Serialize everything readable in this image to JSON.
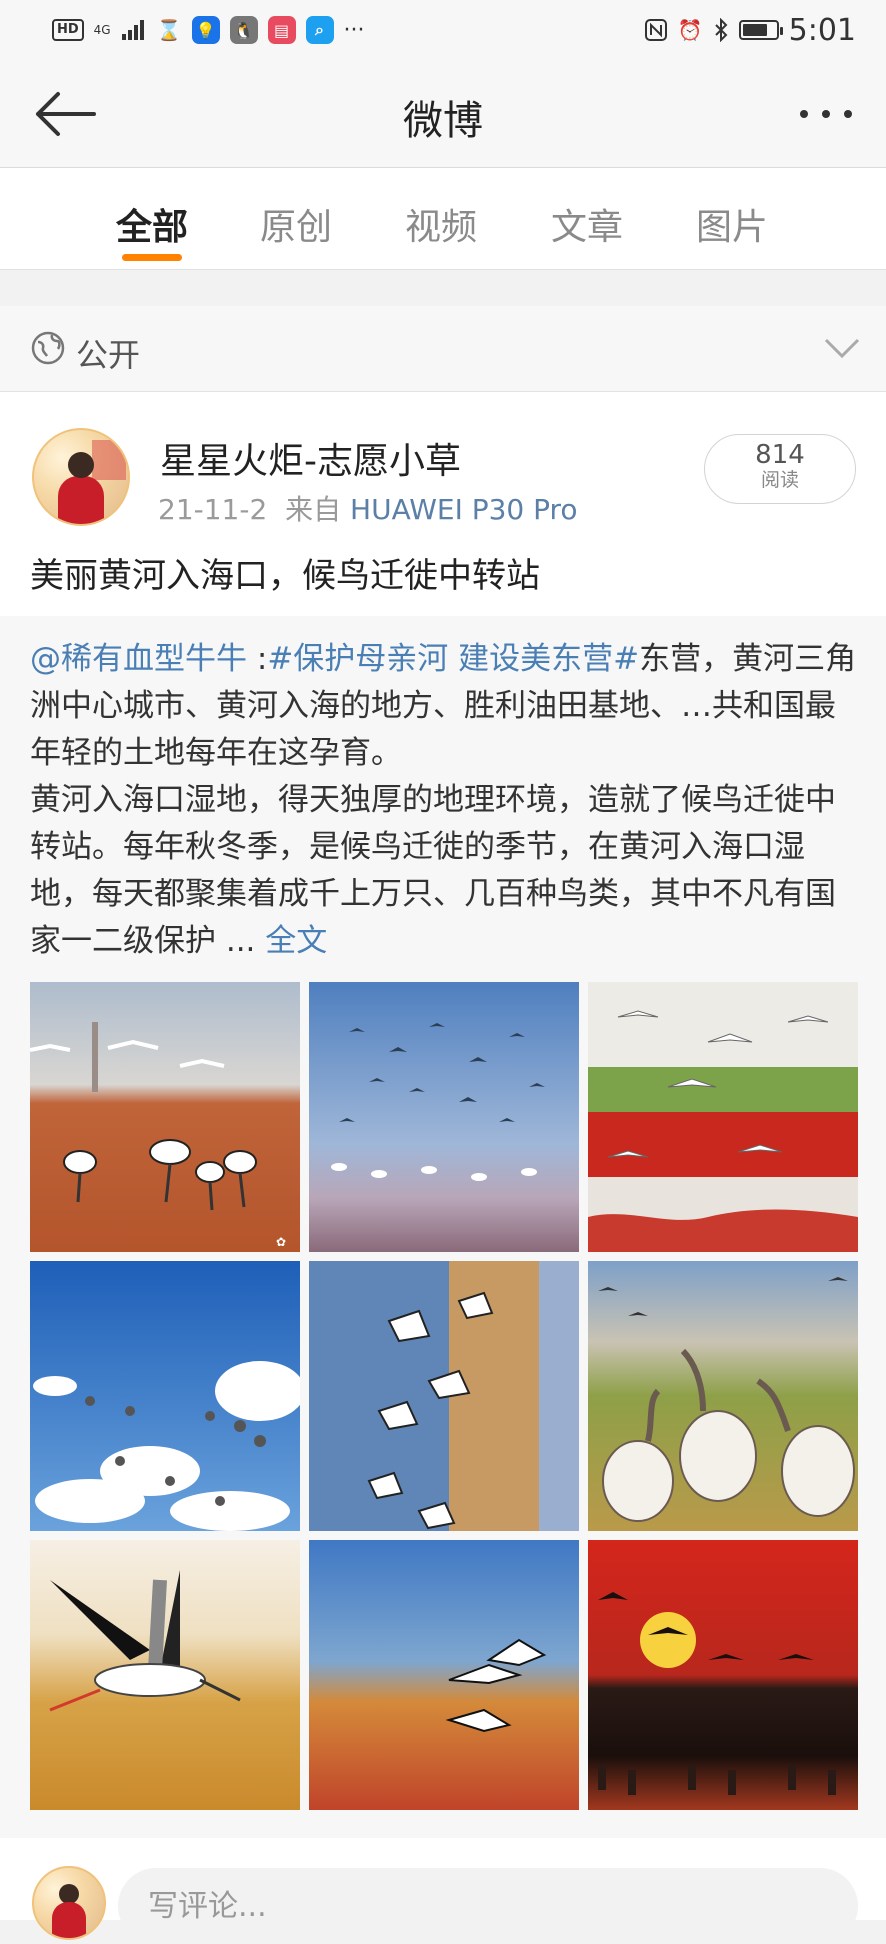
{
  "status_bar": {
    "hd": "HD",
    "signal": "4G",
    "time": "5:01",
    "more": "···",
    "battery_level": 0.75
  },
  "nav": {
    "title": "微博"
  },
  "tabs": [
    {
      "label": "全部",
      "active": true
    },
    {
      "label": "原创",
      "active": false
    },
    {
      "label": "视频",
      "active": false
    },
    {
      "label": "文章",
      "active": false
    },
    {
      "label": "图片",
      "active": false
    }
  ],
  "visibility": {
    "label": "公开"
  },
  "post": {
    "user_name": "星星火炬-志愿小草",
    "date": "21-11-2",
    "source_prefix": "来自",
    "device": "HUAWEI P30 Pro",
    "read_count": "814",
    "read_label": "阅读",
    "title": "美丽黄河入海口，候鸟迁徙中转站"
  },
  "repost": {
    "mention": "@稀有血型牛牛",
    "colon": " :",
    "hashtag": "#保护母亲河 建设美东营#",
    "text": "东营，黄河三角洲中心城市、黄河入海的地方、胜利油田基地、…共和国最年轻的土地每年在这孕育。\n黄河入海口湿地，得天独厚的地理环境，造就了候鸟迁徙中转站。每年秋冬季，是候鸟迁徙的季节，在黄河入海口湿地，每天都聚集着成千上万只、几百种鸟类，其中不凡有国家一二级保护 ... ",
    "full_text_link": "全文"
  },
  "images": [
    {
      "name": "cranes-on-red-beach-photo"
    },
    {
      "name": "flock-over-water-photo"
    },
    {
      "name": "egrets-over-red-marsh-photo"
    },
    {
      "name": "birds-in-blue-sky-photo"
    },
    {
      "name": "cranes-in-flight-lake-photo"
    },
    {
      "name": "cranes-in-grass-photo"
    },
    {
      "name": "stork-flying-photo"
    },
    {
      "name": "cranes-over-orange-land-photo"
    },
    {
      "name": "sunset-swans-photo"
    }
  ],
  "comment_bar": {
    "placeholder": "写评论..."
  },
  "colors": {
    "accent": "#ff8200",
    "link": "#4a7fb5"
  }
}
